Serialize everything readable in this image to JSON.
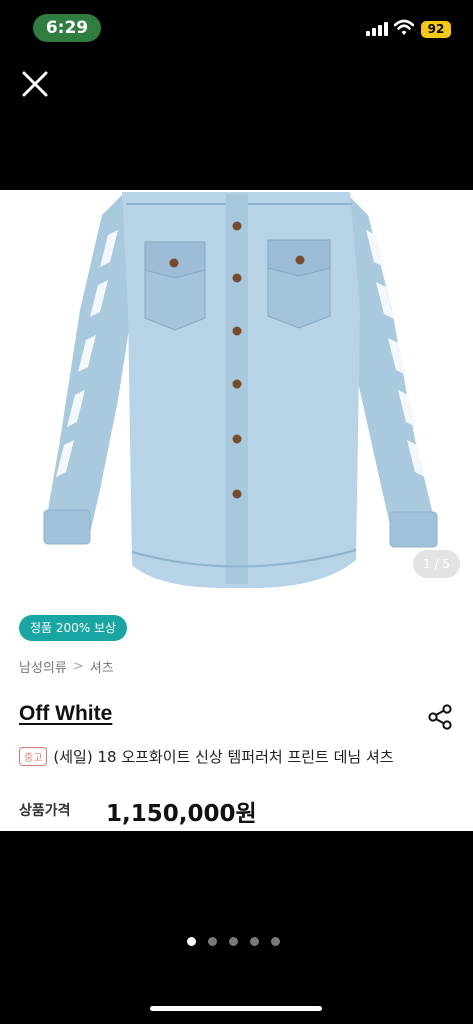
{
  "status": {
    "time": "6:29",
    "battery": "92"
  },
  "colors": {
    "time_pill": "#2f7d3f",
    "battery": "#f3c914",
    "badge": "#1aa5a5",
    "condition_tag": "#e07a6e"
  },
  "image": {
    "counter": "1 / 5"
  },
  "product": {
    "badge": "정품 200% 보상",
    "breadcrumb": {
      "category": "남성의류",
      "subcategory": "셔츠"
    },
    "brand": "Off White",
    "condition": "중고",
    "title": "(세일) 18 오프화이트 신상 템퍼러처 프린트 데님 셔츠",
    "price_label": "상품가격",
    "price": "1,150,000원"
  },
  "pager": {
    "total": 5,
    "active": 1
  },
  "icons": {
    "close": "close-icon",
    "share": "share-icon",
    "signal": "signal-icon",
    "wifi": "wifi-icon"
  }
}
